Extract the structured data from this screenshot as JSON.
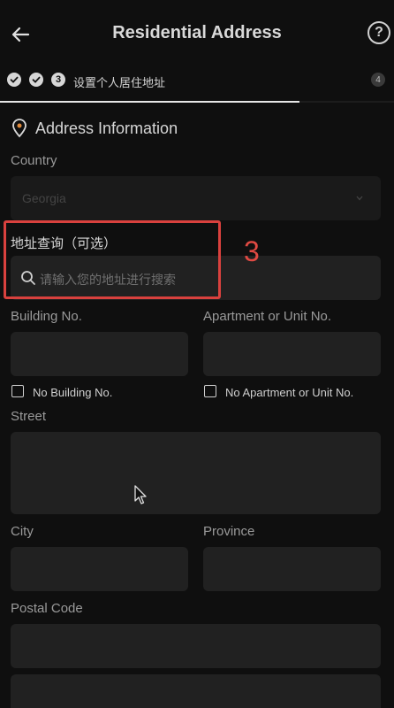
{
  "header": {
    "title": "Residential Address",
    "help_symbol": "?"
  },
  "stepper": {
    "current_step_number": "3",
    "current_step_label": "设置个人居住地址",
    "last_step_number": "4",
    "progress_fraction": 0.76
  },
  "section": {
    "title": "Address Information"
  },
  "country": {
    "label": "Country",
    "value": "Georgia"
  },
  "address_search": {
    "label": "地址查询（可选）",
    "placeholder": "请输入您的地址进行搜索"
  },
  "building": {
    "label": "Building No.",
    "checkbox_label": "No Building No."
  },
  "apartment": {
    "label": "Apartment or Unit No.",
    "checkbox_label": "No Apartment or Unit No."
  },
  "street": {
    "label": "Street"
  },
  "city": {
    "label": "City"
  },
  "province": {
    "label": "Province"
  },
  "postal_code": {
    "label": "Postal Code"
  },
  "annotation": {
    "callout_number": "3",
    "color": "#d9413e"
  }
}
